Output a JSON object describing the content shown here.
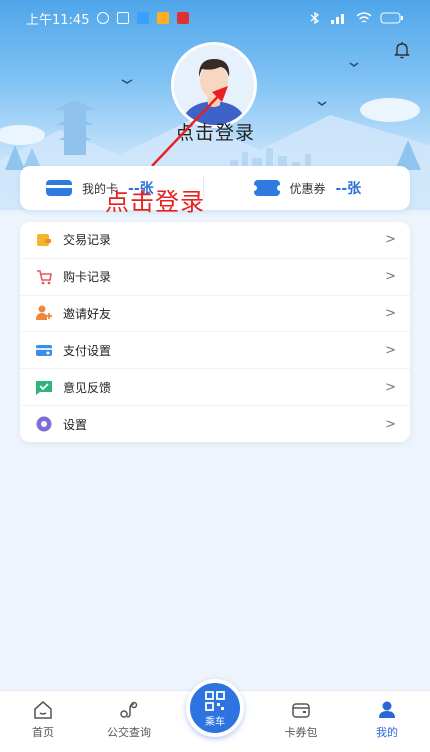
{
  "status_bar": {
    "time": "上午11:45"
  },
  "header": {
    "login_text": "点击登录"
  },
  "stats": {
    "my_card_label": "我的卡",
    "my_card_value": "--张",
    "coupon_label": "优惠券",
    "coupon_value": "--张"
  },
  "annotation": {
    "text": "点击登录",
    "color": "#e82020"
  },
  "menu": {
    "items": [
      {
        "label": "交易记录",
        "icon": "transaction-icon"
      },
      {
        "label": "购卡记录",
        "icon": "cart-icon"
      },
      {
        "label": "邀请好友",
        "icon": "invite-friends-icon"
      },
      {
        "label": "支付设置",
        "icon": "payment-card-icon"
      },
      {
        "label": "意见反馈",
        "icon": "feedback-icon"
      },
      {
        "label": "设置",
        "icon": "settings-icon"
      }
    ]
  },
  "tabbar": {
    "items": [
      {
        "label": "首页",
        "icon": "home-icon"
      },
      {
        "label": "公交查询",
        "icon": "bus-route-icon"
      },
      {
        "label": "乘车",
        "icon": "qr-code-icon"
      },
      {
        "label": "卡券包",
        "icon": "wallet-icon"
      },
      {
        "label": "我的",
        "icon": "user-icon"
      }
    ],
    "active": "我的"
  },
  "colors": {
    "accent": "#2d74e0",
    "value_blue": "#2d6fd6"
  }
}
